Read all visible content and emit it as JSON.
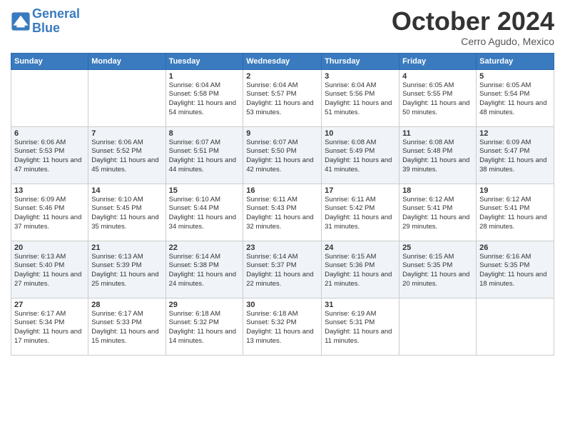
{
  "header": {
    "logo_line1": "General",
    "logo_line2": "Blue",
    "month": "October 2024",
    "location": "Cerro Agudo, Mexico"
  },
  "weekdays": [
    "Sunday",
    "Monday",
    "Tuesday",
    "Wednesday",
    "Thursday",
    "Friday",
    "Saturday"
  ],
  "weeks": [
    [
      {
        "day": "",
        "info": ""
      },
      {
        "day": "",
        "info": ""
      },
      {
        "day": "1",
        "info": "Sunrise: 6:04 AM\nSunset: 5:58 PM\nDaylight: 11 hours and 54 minutes."
      },
      {
        "day": "2",
        "info": "Sunrise: 6:04 AM\nSunset: 5:57 PM\nDaylight: 11 hours and 53 minutes."
      },
      {
        "day": "3",
        "info": "Sunrise: 6:04 AM\nSunset: 5:56 PM\nDaylight: 11 hours and 51 minutes."
      },
      {
        "day": "4",
        "info": "Sunrise: 6:05 AM\nSunset: 5:55 PM\nDaylight: 11 hours and 50 minutes."
      },
      {
        "day": "5",
        "info": "Sunrise: 6:05 AM\nSunset: 5:54 PM\nDaylight: 11 hours and 48 minutes."
      }
    ],
    [
      {
        "day": "6",
        "info": "Sunrise: 6:06 AM\nSunset: 5:53 PM\nDaylight: 11 hours and 47 minutes."
      },
      {
        "day": "7",
        "info": "Sunrise: 6:06 AM\nSunset: 5:52 PM\nDaylight: 11 hours and 45 minutes."
      },
      {
        "day": "8",
        "info": "Sunrise: 6:07 AM\nSunset: 5:51 PM\nDaylight: 11 hours and 44 minutes."
      },
      {
        "day": "9",
        "info": "Sunrise: 6:07 AM\nSunset: 5:50 PM\nDaylight: 11 hours and 42 minutes."
      },
      {
        "day": "10",
        "info": "Sunrise: 6:08 AM\nSunset: 5:49 PM\nDaylight: 11 hours and 41 minutes."
      },
      {
        "day": "11",
        "info": "Sunrise: 6:08 AM\nSunset: 5:48 PM\nDaylight: 11 hours and 39 minutes."
      },
      {
        "day": "12",
        "info": "Sunrise: 6:09 AM\nSunset: 5:47 PM\nDaylight: 11 hours and 38 minutes."
      }
    ],
    [
      {
        "day": "13",
        "info": "Sunrise: 6:09 AM\nSunset: 5:46 PM\nDaylight: 11 hours and 37 minutes."
      },
      {
        "day": "14",
        "info": "Sunrise: 6:10 AM\nSunset: 5:45 PM\nDaylight: 11 hours and 35 minutes."
      },
      {
        "day": "15",
        "info": "Sunrise: 6:10 AM\nSunset: 5:44 PM\nDaylight: 11 hours and 34 minutes."
      },
      {
        "day": "16",
        "info": "Sunrise: 6:11 AM\nSunset: 5:43 PM\nDaylight: 11 hours and 32 minutes."
      },
      {
        "day": "17",
        "info": "Sunrise: 6:11 AM\nSunset: 5:42 PM\nDaylight: 11 hours and 31 minutes."
      },
      {
        "day": "18",
        "info": "Sunrise: 6:12 AM\nSunset: 5:41 PM\nDaylight: 11 hours and 29 minutes."
      },
      {
        "day": "19",
        "info": "Sunrise: 6:12 AM\nSunset: 5:41 PM\nDaylight: 11 hours and 28 minutes."
      }
    ],
    [
      {
        "day": "20",
        "info": "Sunrise: 6:13 AM\nSunset: 5:40 PM\nDaylight: 11 hours and 27 minutes."
      },
      {
        "day": "21",
        "info": "Sunrise: 6:13 AM\nSunset: 5:39 PM\nDaylight: 11 hours and 25 minutes."
      },
      {
        "day": "22",
        "info": "Sunrise: 6:14 AM\nSunset: 5:38 PM\nDaylight: 11 hours and 24 minutes."
      },
      {
        "day": "23",
        "info": "Sunrise: 6:14 AM\nSunset: 5:37 PM\nDaylight: 11 hours and 22 minutes."
      },
      {
        "day": "24",
        "info": "Sunrise: 6:15 AM\nSunset: 5:36 PM\nDaylight: 11 hours and 21 minutes."
      },
      {
        "day": "25",
        "info": "Sunrise: 6:15 AM\nSunset: 5:35 PM\nDaylight: 11 hours and 20 minutes."
      },
      {
        "day": "26",
        "info": "Sunrise: 6:16 AM\nSunset: 5:35 PM\nDaylight: 11 hours and 18 minutes."
      }
    ],
    [
      {
        "day": "27",
        "info": "Sunrise: 6:17 AM\nSunset: 5:34 PM\nDaylight: 11 hours and 17 minutes."
      },
      {
        "day": "28",
        "info": "Sunrise: 6:17 AM\nSunset: 5:33 PM\nDaylight: 11 hours and 15 minutes."
      },
      {
        "day": "29",
        "info": "Sunrise: 6:18 AM\nSunset: 5:32 PM\nDaylight: 11 hours and 14 minutes."
      },
      {
        "day": "30",
        "info": "Sunrise: 6:18 AM\nSunset: 5:32 PM\nDaylight: 11 hours and 13 minutes."
      },
      {
        "day": "31",
        "info": "Sunrise: 6:19 AM\nSunset: 5:31 PM\nDaylight: 11 hours and 11 minutes."
      },
      {
        "day": "",
        "info": ""
      },
      {
        "day": "",
        "info": ""
      }
    ]
  ]
}
